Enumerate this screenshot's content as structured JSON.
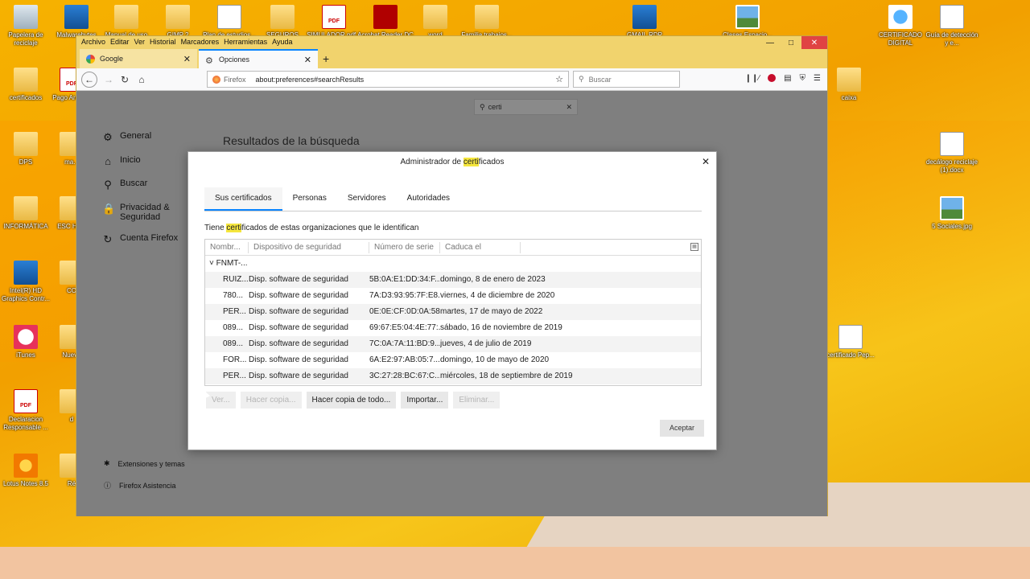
{
  "desktop_icons": [
    {
      "label": "Papelera de reciclaje",
      "kind": "bin"
    },
    {
      "label": "Malwarebytes",
      "kind": "blueapp"
    },
    {
      "label": "Manual de uso de...",
      "kind": "folder"
    },
    {
      "label": "GIMP 2",
      "kind": "folder"
    },
    {
      "label": "Plan de estudios...",
      "kind": "doc"
    },
    {
      "label": "SEGUROS",
      "kind": "folder"
    },
    {
      "label": "SIMULADOR pdf...",
      "kind": "pdf"
    },
    {
      "label": "Acrobat Reader DC",
      "kind": "red"
    },
    {
      "label": "word",
      "kind": "folder"
    },
    {
      "label": "Familia trabajos...",
      "kind": "folder"
    },
    {
      "label": "GMAIL.RDP",
      "kind": "blueapp"
    },
    {
      "label": "Clases Espacio...",
      "kind": "img"
    },
    {
      "label": "CERTIFICADO DIGITAL",
      "kind": "ie"
    },
    {
      "label": "Guía de detección y e...",
      "kind": "doc"
    },
    {
      "label": "certificados",
      "kind": "folder"
    },
    {
      "label": "Pago Arcadia",
      "kind": "pdf"
    },
    {
      "label": "caixa",
      "kind": "folder"
    },
    {
      "label": "DPS",
      "kind": "folder"
    },
    {
      "label": "ma...",
      "kind": "folder"
    },
    {
      "label": "decálogo reciclaje (1).docx",
      "kind": "doc"
    },
    {
      "label": "INFORMÁTICA",
      "kind": "folder"
    },
    {
      "label": "ESC HAC",
      "kind": "folder"
    },
    {
      "label": "5 Sociales.jpg",
      "kind": "img"
    },
    {
      "label": "Intel(R) HD Graphics Contr...",
      "kind": "blueapp"
    },
    {
      "label": "CO",
      "kind": "folder"
    },
    {
      "label": "iTunes",
      "kind": "itunes"
    },
    {
      "label": "Nueva",
      "kind": "folder"
    },
    {
      "label": "certificado Pep...",
      "kind": "doc"
    },
    {
      "label": "Declaracion Responsable ...",
      "kind": "pdf"
    },
    {
      "label": "d",
      "kind": "folder"
    },
    {
      "label": "Lotus Notes 8.5",
      "kind": "lotus"
    },
    {
      "label": "Ré",
      "kind": "folder"
    }
  ],
  "browser": {
    "menu": [
      "Archivo",
      "Editar",
      "Ver",
      "Historial",
      "Marcadores",
      "Herramientas",
      "Ayuda"
    ],
    "tabs": [
      {
        "label": "Google",
        "active": false
      },
      {
        "label": "Opciones",
        "active": true
      }
    ],
    "url_brand": "Firefox",
    "url": "about:preferences#searchResults",
    "search_placeholder": "Buscar"
  },
  "prefs": {
    "search_value": "certi",
    "categories": [
      {
        "label": "General",
        "icon": "gear-icon"
      },
      {
        "label": "Inicio",
        "icon": "home-icon"
      },
      {
        "label": "Buscar",
        "icon": "search-icon"
      },
      {
        "label": "Privacidad & Seguridad",
        "icon": "lock-icon"
      },
      {
        "label": "Cuenta Firefox",
        "icon": "sync-icon"
      }
    ],
    "results_title": "Resultados de la búsqueda",
    "bottom_links": [
      "Extensiones y temas",
      "Firefox Asistencia"
    ]
  },
  "dialog": {
    "title_pre": "Administrador de ",
    "title_hl": "certi",
    "title_post": "ficados",
    "tabs": [
      "Sus certificados",
      "Personas",
      "Servidores",
      "Autoridades"
    ],
    "desc_pre": "Tiene ",
    "desc_hl": "certi",
    "desc_post": "ficados de estas organizaciones que le identifican",
    "columns": [
      "Nombr...",
      "Dispositivo de seguridad",
      "Número de serie",
      "Caduca el"
    ],
    "group": "FNMT-...",
    "rows": [
      [
        "RUIZ...",
        "Disp. software de seguridad",
        "5B:0A:E1:DD:34:F...",
        "domingo, 8 de enero de 2023"
      ],
      [
        "780...",
        "Disp. software de seguridad",
        "7A:D3:93:95:7F:E8...",
        "viernes, 4 de diciembre de 2020"
      ],
      [
        "PER...",
        "Disp. software de seguridad",
        "0E:0E:CF:0D:0A:58...",
        "martes, 17 de mayo de 2022"
      ],
      [
        "089...",
        "Disp. software de seguridad",
        "69:67:E5:04:4E:77:...",
        "sábado, 16 de noviembre de 2019"
      ],
      [
        "089...",
        "Disp. software de seguridad",
        "7C:0A:7A:11:BD:9...",
        "jueves, 4 de julio de 2019"
      ],
      [
        "FOR...",
        "Disp. software de seguridad",
        "6A:E2:97:AB:05:7...",
        "domingo, 10 de mayo de 2020"
      ],
      [
        "PER...",
        "Disp. software de seguridad",
        "3C:27:28:BC:67:C...",
        "miércoles, 18 de septiembre de 2019"
      ]
    ],
    "buttons": [
      {
        "label": "Ver...",
        "enabled": false
      },
      {
        "label": "Hacer copia...",
        "enabled": false
      },
      {
        "label": "Hacer copia de todo...",
        "enabled": true
      },
      {
        "label": "Importar...",
        "enabled": true
      },
      {
        "label": "Eliminar...",
        "enabled": false
      }
    ],
    "accept": "Aceptar"
  }
}
